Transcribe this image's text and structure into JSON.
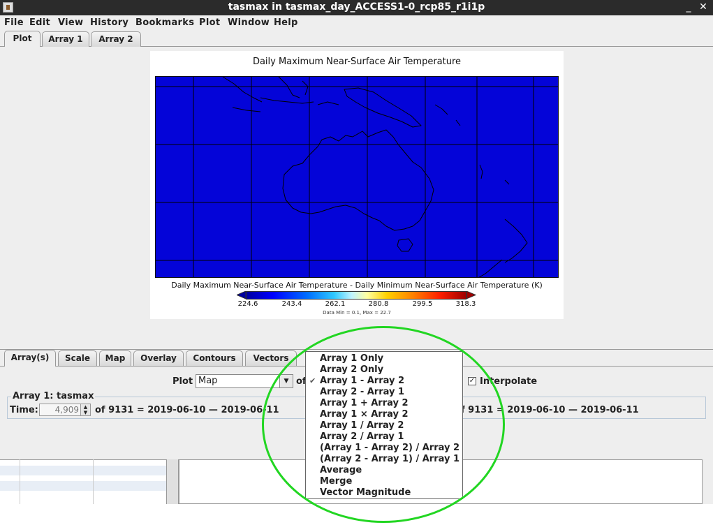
{
  "window": {
    "title": "tasmax in tasmax_day_ACCESS1-0_rcp85_r1i1p",
    "minimize_glyph": "_",
    "close_glyph": "✕"
  },
  "menubar": [
    "File",
    "Edit",
    "View",
    "History",
    "Bookmarks",
    "Plot",
    "Window",
    "Help"
  ],
  "top_tabs": [
    "Plot",
    "Array 1",
    "Array 2"
  ],
  "plot": {
    "title": "Daily Maximum Near-Surface Air Temperature",
    "scale_label": "Daily Maximum Near-Surface Air Temperature - Daily Minimum Near-Surface Air Temperature (K)",
    "colorbar_ticks": [
      "224.6",
      "243.4",
      "262.1",
      "280.8",
      "299.5",
      "318.3"
    ],
    "data_range": "Data Min = 0.1, Max = 22.7",
    "map_fill_color": "#0404d8"
  },
  "bottom_tabs": [
    "Array(s)",
    "Scale",
    "Map",
    "Overlay",
    "Contours",
    "Vectors"
  ],
  "controls": {
    "plot_label": "Plot",
    "plot_type": "Map",
    "of_label": "of",
    "interpolate_label": "Interpolate",
    "interpolate_checked": "✓",
    "array1_title": "Array 1: tasmax",
    "time_label": "Time:",
    "time_value": "4,909",
    "time_range_left": "of 9131 = 2019-06-10 — 2019-06-11",
    "time_range_right": "f 9131 = 2019-06-10 — 2019-06-11"
  },
  "popup_menu": {
    "items": [
      "Array 1 Only",
      "Array 2 Only",
      "Array 1 - Array 2",
      "Array 2 - Array 1",
      "Array 1 + Array 2",
      "Array 1 × Array 2",
      "Array 1 / Array 2",
      "Array 2 / Array 1",
      "(Array 1 - Array 2) / Array 2",
      "(Array 2 - Array 1) / Array 1",
      "Average",
      "Merge",
      "Vector Magnitude"
    ],
    "checked_item": "Array 1 - Array 2",
    "check_glyph": "✔"
  },
  "highlight_color": "#22d622"
}
